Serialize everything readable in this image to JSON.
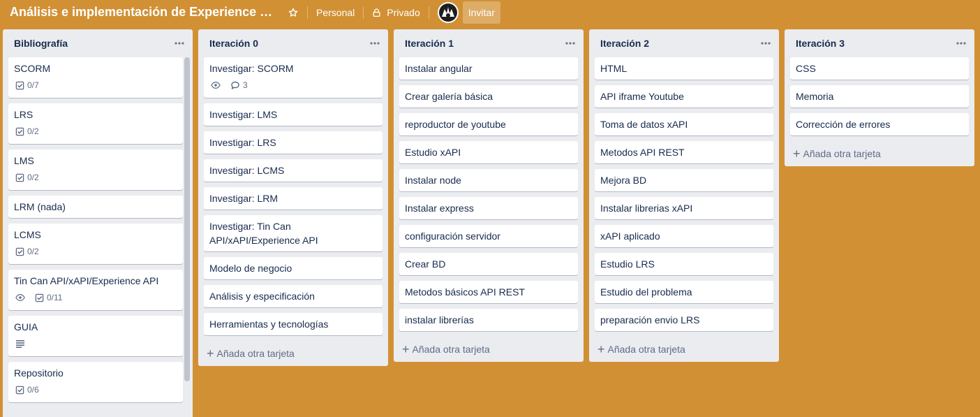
{
  "board": {
    "title": "Análisis e implementación de Experience …",
    "team": "Personal",
    "visibility": "Privado",
    "invite_label": "Invitar",
    "star_icon": "star-icon",
    "lock_icon": "lock-icon"
  },
  "lists": [
    {
      "title": "Bibliografía",
      "cards": [
        {
          "title": "SCORM",
          "checklist": "0/7"
        },
        {
          "title": "LRS",
          "checklist": "0/2"
        },
        {
          "title": "LMS",
          "checklist": "0/2"
        },
        {
          "title": "LRM (nada)"
        },
        {
          "title": "LCMS",
          "checklist": "0/2"
        },
        {
          "title": "Tin Can API/xAPI/Experience API",
          "watch": true,
          "checklist": "0/11"
        },
        {
          "title": "GUIA",
          "description": true
        },
        {
          "title": "Repositorio",
          "checklist": "0/6"
        }
      ]
    },
    {
      "title": "Iteración 0",
      "cards": [
        {
          "title": "Investigar: SCORM",
          "watch": true,
          "comments": "3"
        },
        {
          "title": "Investigar: LMS"
        },
        {
          "title": "Investigar: LRS"
        },
        {
          "title": "Investigar: LCMS"
        },
        {
          "title": "Investigar: LRM"
        },
        {
          "title": "Investigar: Tin Can API/xAPI/Experience API"
        },
        {
          "title": "Modelo de negocio"
        },
        {
          "title": "Análisis y especificación"
        },
        {
          "title": "Herramientas y tecnologías"
        }
      ],
      "add_label": "Añada otra tarjeta"
    },
    {
      "title": "Iteración 1",
      "cards": [
        {
          "title": "Instalar angular"
        },
        {
          "title": "Crear galería básica"
        },
        {
          "title": "reproductor de youtube"
        },
        {
          "title": "Estudio xAPI"
        },
        {
          "title": "Instalar node"
        },
        {
          "title": "Instalar express"
        },
        {
          "title": "configuración servidor"
        },
        {
          "title": "Crear BD"
        },
        {
          "title": "Metodos básicos API REST"
        },
        {
          "title": "instalar librerías"
        }
      ],
      "add_label": "Añada otra tarjeta"
    },
    {
      "title": "Iteración 2",
      "cards": [
        {
          "title": "HTML"
        },
        {
          "title": "API iframe Youtube"
        },
        {
          "title": "Toma de datos xAPI"
        },
        {
          "title": "Metodos API REST"
        },
        {
          "title": "Mejora BD"
        },
        {
          "title": "Instalar librerias xAPI"
        },
        {
          "title": "xAPI aplicado"
        },
        {
          "title": "Estudio LRS"
        },
        {
          "title": "Estudio del problema"
        },
        {
          "title": "preparación envio LRS"
        }
      ],
      "add_label": "Añada otra tarjeta"
    },
    {
      "title": "Iteración 3",
      "cards": [
        {
          "title": "CSS"
        },
        {
          "title": "Memoria"
        },
        {
          "title": "Corrección de errores"
        }
      ],
      "add_label": "Añada otra tarjeta"
    }
  ],
  "colors": {
    "board_background": "#d29034",
    "list_background": "#ebecf0",
    "card_background": "#ffffff",
    "text": "#172b4d",
    "muted_text": "#5e6c84"
  }
}
